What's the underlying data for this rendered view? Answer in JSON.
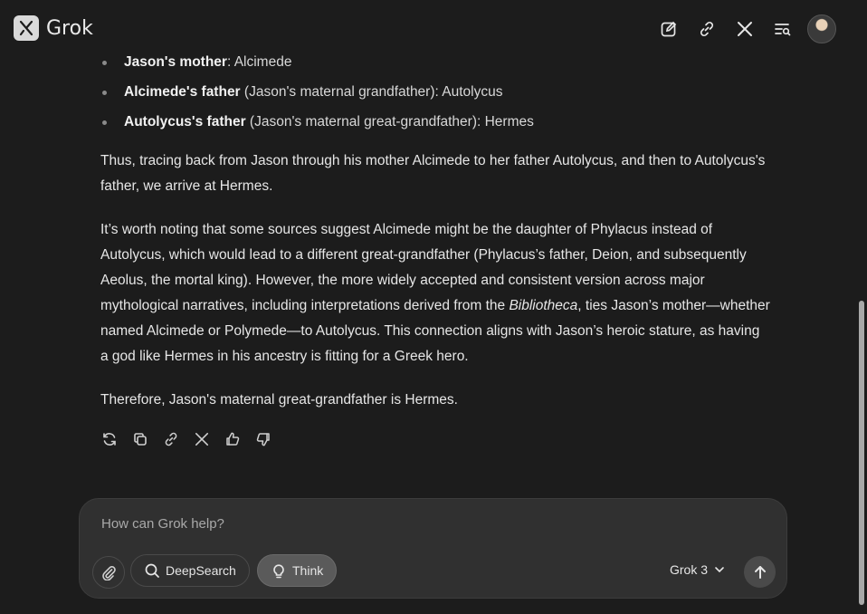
{
  "app": {
    "name": "Grok"
  },
  "header": {
    "icons": [
      "edit-icon",
      "link-icon",
      "x-icon",
      "history-search-icon",
      "avatar"
    ]
  },
  "message": {
    "bullets": [
      {
        "bold": "Jason's mother",
        "rest": ": Alcimede"
      },
      {
        "bold": "Alcimede's father",
        "rest": " (Jason's maternal grandfather): Autolycus"
      },
      {
        "bold": "Autolycus's father",
        "rest": " (Jason's maternal great-grandfather): Hermes"
      }
    ],
    "para1": "Thus, tracing back from Jason through his mother Alcimede to her father Autolycus, and then to Autolycus's father, we arrive at Hermes.",
    "para2_a": "It’s worth noting that some sources suggest Alcimede might be the daughter of Phylacus instead of Autolycus, which would lead to a different great-grandfather (Phylacus’s father, Deion, and subsequently Aeolus, the mortal king). However, the more widely accepted and consistent version across major mythological narratives, including interpretations derived from the ",
    "para2_italic": "Bibliotheca",
    "para2_b": ", ties Jason’s mother—whether named Alcimede or Polymede—to Autolycus. This connection aligns with Jason’s heroic stature, as having a god like Hermes in his ancestry is fitting for a Greek hero.",
    "para3": "Therefore, Jason's maternal great-grandfather is Hermes."
  },
  "message_actions": [
    "regenerate-icon",
    "copy-icon",
    "link-icon",
    "x-share-icon",
    "thumbs-up-icon",
    "thumbs-down-icon"
  ],
  "composer": {
    "placeholder": "How can Grok help?",
    "deepsearch_label": "DeepSearch",
    "think_label": "Think",
    "model_label": "Grok 3"
  },
  "colors": {
    "background": "#1c1c1c",
    "composer": "#303030",
    "think_active": "#5a5a5a"
  }
}
